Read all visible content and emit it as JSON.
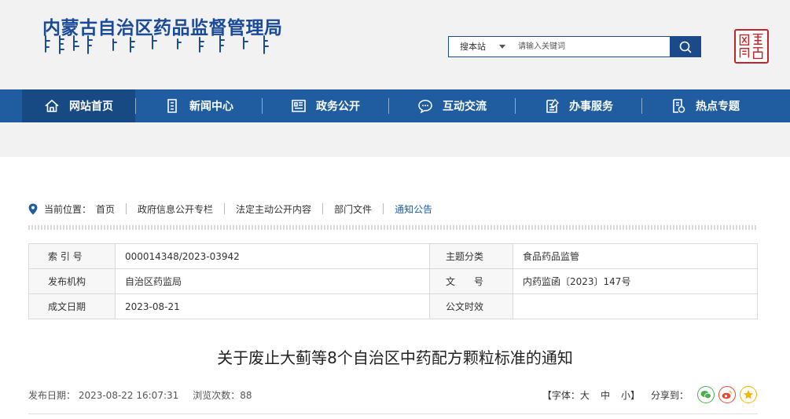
{
  "header": {
    "site_title": "内蒙古自治区药品监督管理局",
    "search": {
      "scope": "搜本站",
      "placeholder": "请输入关键词"
    }
  },
  "nav": {
    "items": [
      {
        "label": "网站首页",
        "icon": "home-icon"
      },
      {
        "label": "新闻中心",
        "icon": "news-icon"
      },
      {
        "label": "政务公开",
        "icon": "gov-affairs-icon"
      },
      {
        "label": "互动交流",
        "icon": "chat-icon"
      },
      {
        "label": "办事服务",
        "icon": "service-icon"
      },
      {
        "label": "热点专题",
        "icon": "topic-icon"
      }
    ]
  },
  "breadcrumb": {
    "prefix": "当前位置：",
    "items": [
      "首页",
      "政府信息公开专栏",
      "法定主动公开内容",
      "部门文件",
      "通知公告"
    ]
  },
  "info": {
    "index_label": "索 引 号",
    "index_value": "000014348/2023-03942",
    "topic_label": "主题分类",
    "topic_value": "食品药品监管",
    "publisher_label": "发布机构",
    "publisher_value": "自治区药监局",
    "docno_label": "文　　号",
    "docno_value": "内药监函〔2023〕147号",
    "date_label": "成文日期",
    "date_value": "2023-08-21",
    "validity_label": "公文时效",
    "validity_value": ""
  },
  "article": {
    "title": "关于废止大蓟等8个自治区中药配方颗粒标准的通知",
    "publish_date": "发布日期：  2023-08-22 16:07:31",
    "views": "浏览次数：88"
  },
  "tools": {
    "font_prefix": "【字体：",
    "font_large": "大",
    "font_medium": "中",
    "font_small": "小",
    "font_suffix": "】",
    "share_label": "分享到：",
    "colors": {
      "wechat": "#4caf50",
      "weibo": "#e6492d",
      "qzone": "#f5b800"
    }
  },
  "colors": {
    "nav": "#1f5da0",
    "nav_active": "#174a83",
    "title_blue": "#1a4a9a",
    "seal_red": "#c3252b"
  }
}
